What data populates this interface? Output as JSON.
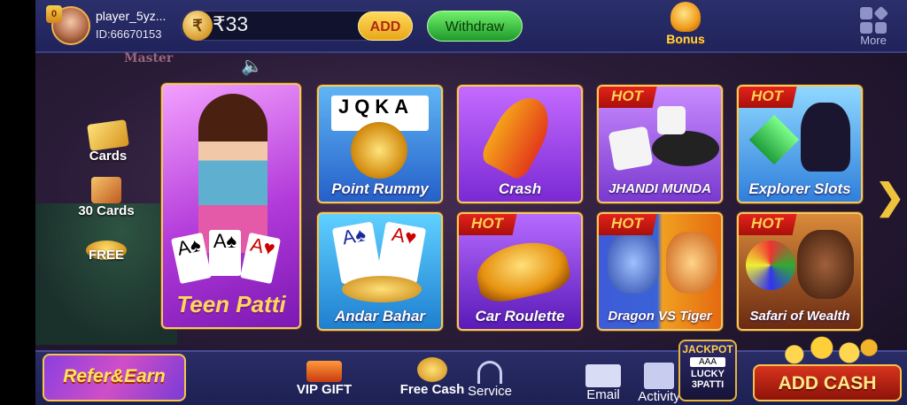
{
  "header": {
    "level": "0",
    "player_name": "player_5yz...",
    "player_id": "ID:66670153",
    "currency_symbol": "₹",
    "balance": "₹33",
    "add_label": "ADD",
    "withdraw_label": "Withdraw",
    "bonus_label": "Bonus",
    "more_label": "More"
  },
  "background": {
    "sign_text": "Master"
  },
  "side_menu": [
    {
      "label": "Cards"
    },
    {
      "label": "30 Cards"
    },
    {
      "label": "FREE"
    }
  ],
  "hot_label": "HOT",
  "games": [
    {
      "label": "Teen Patti",
      "hot": false
    },
    {
      "label": "Point Rummy",
      "hot": false
    },
    {
      "label": "Crash",
      "hot": false
    },
    {
      "label": "JHANDI MUNDA",
      "hot": true
    },
    {
      "label": "Explorer Slots",
      "hot": true
    },
    {
      "label": "Andar Bahar",
      "hot": false
    },
    {
      "label": "Car Roulette",
      "hot": true
    },
    {
      "label": "Dragon VS Tiger",
      "hot": true
    },
    {
      "label": "Safari of Wealth",
      "hot": true
    }
  ],
  "bottom": {
    "refer_label": "Refer&Earn",
    "vip_label": "VIP GIFT",
    "free_cash_label": "Free Cash",
    "service_label": "Service",
    "email_label": "Email",
    "activity_label": "Activity",
    "jackpot_top": "JACKPOT",
    "jackpot_cards": "AAA",
    "jackpot_bottom": "LUCKY 3PATTI",
    "add_cash_label": "ADD CASH"
  },
  "colors": {
    "accent_gold": "#f2c86a",
    "hot_red": "#d8241c",
    "withdraw_green": "#1f9a2b",
    "add_yellow": "#ffd95a"
  }
}
